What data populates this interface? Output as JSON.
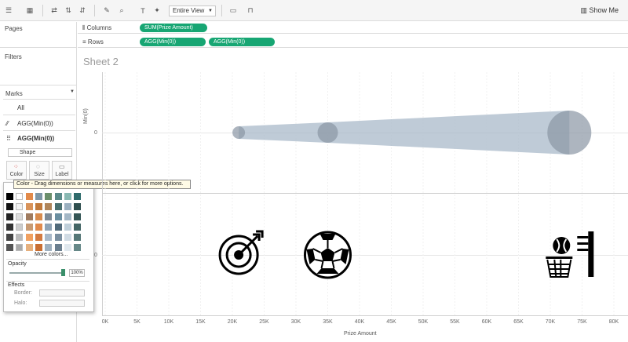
{
  "toolbar": {
    "view_select": "Entire View",
    "show_me": "Show Me"
  },
  "panes": {
    "pages": "Pages",
    "filters": "Filters",
    "marks": "Marks"
  },
  "shelves": {
    "columns_label": "Columns",
    "rows_label": "Rows",
    "columns_pill": "SUM(Prize Amount)",
    "rows_pills": [
      "AGG(Min(0))",
      "AGG(Min(0))"
    ]
  },
  "marks_card": {
    "all": "All",
    "row1": "AGG(Min(0))",
    "row2": "AGG(Min(0))",
    "mark_type": "Shape",
    "buttons": [
      "Color",
      "Size",
      "Label"
    ]
  },
  "color_popup": {
    "more_colors": "More colors...",
    "opacity_label": "Opacity",
    "opacity_value": "100%",
    "opacity_fraction": 1.0,
    "effects_label": "Effects",
    "border_label": "Border:",
    "halo_label": "Halo:"
  },
  "tooltip": "Color - Drag dimensions or measures here, or click for more options.",
  "sheet": {
    "title": "Sheet 2",
    "y_axis_title": "Min(0)",
    "y_tick_top": "0",
    "y_tick_bottom": "0",
    "x_axis_title": "Prize Amount"
  },
  "chart_data": {
    "type": "scatter",
    "xlabel": "Prize Amount",
    "ylabel": "Min(0)",
    "xlim": [
      0,
      80000
    ],
    "x_ticks": [
      "0K",
      "5K",
      "10K",
      "15K",
      "20K",
      "25K",
      "30K",
      "35K",
      "40K",
      "45K",
      "50K",
      "55K",
      "60K",
      "65K",
      "70K",
      "75K",
      "80K"
    ],
    "line_points": [
      {
        "x": 21000,
        "y": 0
      },
      {
        "x": 35000,
        "y": 0
      },
      {
        "x": 73000,
        "y": 0
      }
    ],
    "shape_points": [
      {
        "x": 21000,
        "y": 0,
        "icon": "dartboard-target-icon"
      },
      {
        "x": 35000,
        "y": 0,
        "icon": "soccer-ball-icon"
      },
      {
        "x": 73000,
        "y": 0,
        "icon": "basketball-hoop-icon"
      }
    ],
    "colors": {
      "line": "#a9bac9",
      "point": "#8a96a4",
      "grid": "#e6e6e6"
    }
  }
}
